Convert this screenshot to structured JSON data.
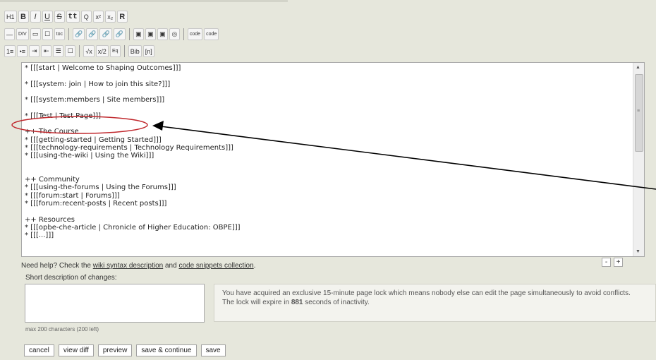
{
  "toolbar": {
    "row1": [
      "H1",
      "B",
      "I",
      "U",
      "S",
      "tt",
      "Q",
      "x²",
      "x₂",
      "R"
    ],
    "row2a": [
      "—",
      "DIV",
      "▭",
      "☐",
      "toc"
    ],
    "row2b": [
      "🔗",
      "🔗",
      "🔗",
      "🔗"
    ],
    "row2c": [
      "▣",
      "▣",
      "▣",
      "◎"
    ],
    "row2d": [
      "code",
      "code"
    ],
    "row3a": [
      "1≡",
      "•≡",
      "⇥",
      "⇤",
      "☰",
      "☐"
    ],
    "row3b": [
      "√x",
      "x/2",
      "Eq"
    ],
    "row3c": [
      "Bib",
      "[n]"
    ],
    "icon_names": [
      "heading-icon",
      "bold-icon",
      "italic-icon",
      "underline-icon",
      "strikethrough-icon",
      "teletype-icon",
      "quote-icon",
      "superscript-icon",
      "subscript-icon",
      "raw-icon"
    ]
  },
  "editor": {
    "lines": [
      "* [[[start | Welcome to Shaping Outcomes]]]",
      "",
      "* [[[system: join | How to join this site?]]]",
      "",
      "* [[[system:members | Site members]]]",
      "",
      "* [[[Test | Test Page]]]",
      "",
      "++ The Course",
      "* [[[getting-started | Getting Started]]]",
      "* [[[technology-requirements | Technology Requirements]]]",
      "* [[[using-the-wiki | Using the Wiki]]]",
      "",
      "",
      "++ Community",
      "* [[[using-the-forums | Using the Forums]]]",
      "* [[[forum:start | Forums]]]",
      "* [[[forum:recent-posts | Recent posts]]]",
      "",
      "++ Resources",
      "* [[[opbe-che-article | Chronicle of Higher Education: OBPE]]]",
      "* [[[...]]]"
    ]
  },
  "help": {
    "prefix": "Need help? Check the ",
    "link1": "wiki syntax description",
    "middle": " and ",
    "link2": "code snippets collection",
    "suffix": "."
  },
  "resize": {
    "minus": "-",
    "plus": "+"
  },
  "short_description": {
    "label": "Short description of changes:",
    "value": "",
    "counter": "max 200 characters (200 left)"
  },
  "lock": {
    "line1": "You have acquired an exclusive 15-minute page lock which means nobody else can edit the page simultaneously to avoid conflicts.",
    "line2_prefix": "The lock will expire in ",
    "seconds": "881",
    "line2_suffix": " seconds of inactivity."
  },
  "buttons": {
    "cancel": "cancel",
    "view_diff": "view diff",
    "preview": "preview",
    "save_continue": "save & continue",
    "save": "save"
  },
  "annotation": {
    "ellipse_color": "#c0282d",
    "arrow_color": "#000000"
  }
}
